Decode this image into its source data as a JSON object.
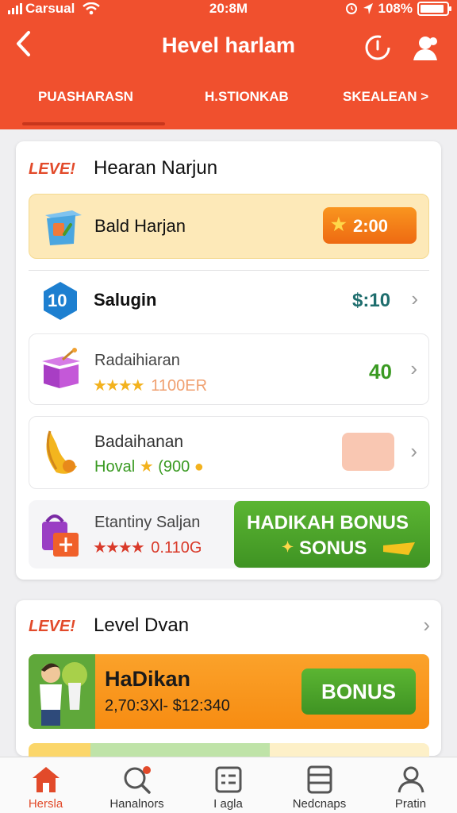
{
  "status_bar": {
    "carrier": "Carsual",
    "time": "20:8M",
    "battery": "108%",
    "battery_level": 0.9
  },
  "header": {
    "title": "Hevel harlam",
    "back_icon": "chevron-left-icon",
    "tabs": [
      "PUASHARASN",
      "H.STIONKAB",
      "SKEALEAN >"
    ],
    "active_tab": 0,
    "colors": {
      "primary": "#f0502e",
      "accent_orange": "#f57c1f",
      "green": "#4ea62a"
    }
  },
  "card1": {
    "level_tag": "LEVE!",
    "title": "Hearan Narjun",
    "featured": {
      "name": "Bald Harjan",
      "button": "2:00"
    },
    "items": [
      {
        "name": "Salugin",
        "badge": "10",
        "value": "$:10"
      },
      {
        "name": "Radaihiaran",
        "stars": "★★★★",
        "sub": "1100ER",
        "value": "40"
      },
      {
        "name": "Badaihanan",
        "sub_label": "Hoval",
        "sub_value": "(900"
      },
      {
        "name": "Etantiny Saljan",
        "stars": "★★★★",
        "sub": "0.110G"
      }
    ],
    "bonus_button": {
      "line1": "HADIKAH BONUS",
      "line2": "SONUS"
    }
  },
  "card2": {
    "level_tag": "LEVE!",
    "title": "Level Dvan",
    "promo": {
      "title": "HaDikan",
      "sub": "2,70:3Xl- $12:340",
      "button": "BONUS"
    }
  },
  "bottom_nav": [
    {
      "label": "Hersla",
      "icon": "home-icon"
    },
    {
      "label": "Hanalnors",
      "icon": "search-icon"
    },
    {
      "label": "I agla",
      "icon": "list-icon"
    },
    {
      "label": "Nedcnaps",
      "icon": "document-icon"
    },
    {
      "label": "Pratin",
      "icon": "profile-icon"
    }
  ]
}
